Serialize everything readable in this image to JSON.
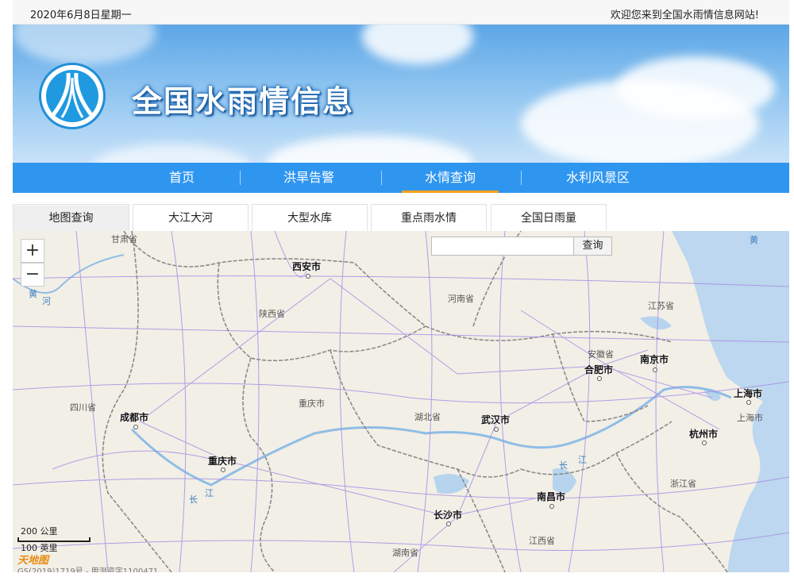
{
  "topbar": {
    "date": "2020年6月8日星期一",
    "welcome": "欢迎您来到全国水雨情信息网站!"
  },
  "banner": {
    "title": "全国水雨情信息"
  },
  "nav": {
    "items": [
      "首页",
      "洪旱告警",
      "水情查询",
      "水利风景区"
    ],
    "active": "水情查询"
  },
  "subtabs": {
    "items": [
      "地图查询",
      "大江大河",
      "大型水库",
      "重点雨水情",
      "全国日雨量"
    ],
    "active": "地图查询"
  },
  "map": {
    "zoom_in": "+",
    "zoom_out": "−",
    "search_placeholder": "",
    "search_button": "查询",
    "provinces": [
      "甘肃省",
      "陕西省",
      "河南省",
      "江苏省",
      "安徽省",
      "四川省",
      "湖北省",
      "重庆市",
      "浙江省",
      "江西省",
      "湖南省"
    ],
    "cities": [
      "西安市",
      "合肥市",
      "南京市",
      "上海市",
      "成都市",
      "武汉市",
      "杭州市",
      "重庆市",
      "南昌市",
      "长沙市"
    ],
    "rivers": [
      "黄",
      "河",
      "长",
      "江",
      "长",
      "江",
      "黄"
    ],
    "minor_label": "上海市",
    "scale_km": "200 公里",
    "scale_mi": "100 英里",
    "brand": "天地图",
    "copyright": "GS(2019)1719号 - 甲测资字1100471"
  },
  "colors": {
    "nav_bg": "#2f96f0",
    "nav_active": "#f8a21e",
    "sea": "#bcd7ef",
    "road": "#a98de6"
  }
}
